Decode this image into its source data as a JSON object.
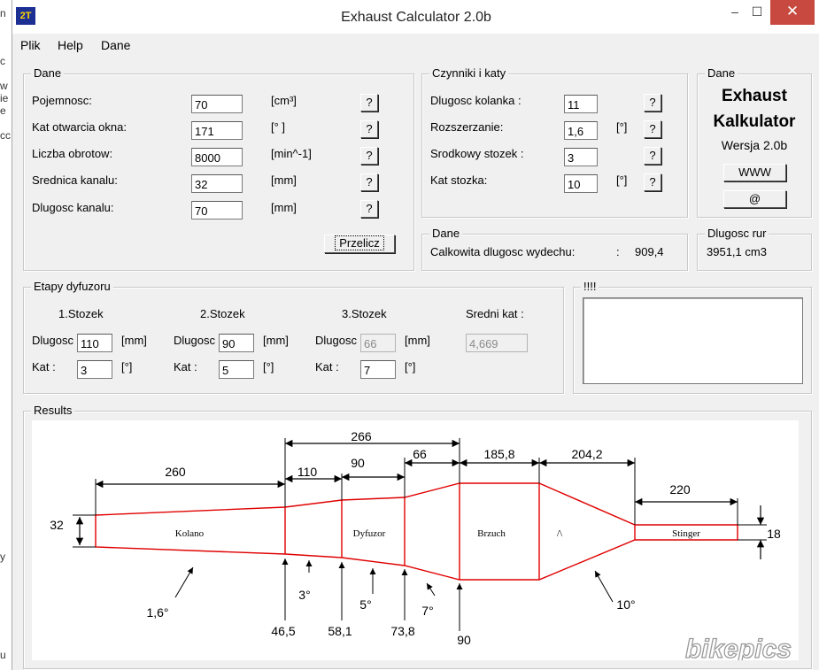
{
  "background_edge_letters": [
    "n",
    "c",
    "ie",
    "w",
    "e",
    "cc",
    "y",
    "u"
  ],
  "window": {
    "title": "Exhaust Calculator 2.0b",
    "logo_text": "2T",
    "minimize": "–",
    "maximize": "☐",
    "close": "✕"
  },
  "menu": [
    "Plik",
    "Help",
    "Dane"
  ],
  "dane_group": {
    "title": "Dane",
    "rows": [
      {
        "label": "Pojemnosc:",
        "value": "70",
        "unit": "[cm³]",
        "help": "?"
      },
      {
        "label": "Kat otwarcia okna:",
        "value": "171",
        "unit": "[° ]",
        "help": "?"
      },
      {
        "label": "Liczba obrotow:",
        "value": "8000",
        "unit": "[min^-1]",
        "help": "?"
      },
      {
        "label": "Srednica kanalu:",
        "value": "32",
        "unit": "[mm]",
        "help": "?"
      },
      {
        "label": "Dlugosc kanalu:",
        "value": "70",
        "unit": "[mm]",
        "help": "?"
      }
    ],
    "calc_button": "Przelicz"
  },
  "czynniki_group": {
    "title": "Czynniki i katy",
    "rows": [
      {
        "label": "Dlugosc kolanka   :",
        "value": "11",
        "unit": "",
        "help": "?"
      },
      {
        "label": "Rozszerzanie:",
        "value": "1,6",
        "unit": "[°]",
        "help": "?"
      },
      {
        "label": "Srodkowy stozek  :",
        "value": "3",
        "unit": "",
        "help": "?"
      },
      {
        "label": "Kat stozka:",
        "value": "10",
        "unit": "[°]",
        "help": "?"
      }
    ]
  },
  "about_group": {
    "title": "Dane",
    "line1": "Exhaust",
    "line2": "Kalkulator",
    "version": "Wersja  2.0b",
    "www_button": "WWW",
    "email_button": "@"
  },
  "total_group": {
    "title": "Dane",
    "label": "Calkowita dlugosc wydechu:",
    "sep": ":",
    "value": "909,4"
  },
  "pipe_group": {
    "title": "Dlugosc rur",
    "value": "3951,1 cm3"
  },
  "etapy_group": {
    "title": "Etapy dyfuzoru",
    "stages": [
      {
        "heading": "1.Stozek",
        "len_label": "Dlugosc",
        "len": "110",
        "len_unit": "[mm]",
        "kat_label": "Kat  :",
        "kat": "3",
        "kat_unit": "[°]",
        "disabled": false
      },
      {
        "heading": "2.Stozek",
        "len_label": "Dlugosc",
        "len": "90",
        "len_unit": "[mm]",
        "kat_label": "Kat  :",
        "kat": "5",
        "kat_unit": "[°]",
        "disabled": false
      },
      {
        "heading": "3.Stozek",
        "len_label": "Dlugosc",
        "len": "66",
        "len_unit": "[mm]",
        "kat_label": "Kat  :",
        "kat": "7",
        "kat_unit": "[°]",
        "disabled": true
      }
    ],
    "mean_label": "Sredni kat  :",
    "mean_value": "4,669"
  },
  "notes_group": {
    "title": "!!!!"
  },
  "results": {
    "title": "Results",
    "watermark": "bikepics",
    "dimensions": {
      "d266": "266",
      "d260": "260",
      "d110": "110",
      "d90": "90",
      "d66": "66",
      "d185": "185,8",
      "d204": "204,2",
      "d220": "220",
      "d32": "32",
      "d18": "18"
    },
    "parts": [
      "Kolano",
      "Dyfuzor",
      "Brzuch",
      "/\\",
      "Stinger"
    ],
    "angles": {
      "a16": "1,6°",
      "a3": "3°",
      "a5": "5°",
      "a7": "7°",
      "a10": "10°"
    },
    "positions": [
      "46,5",
      "58,1",
      "73,8",
      "90"
    ]
  }
}
